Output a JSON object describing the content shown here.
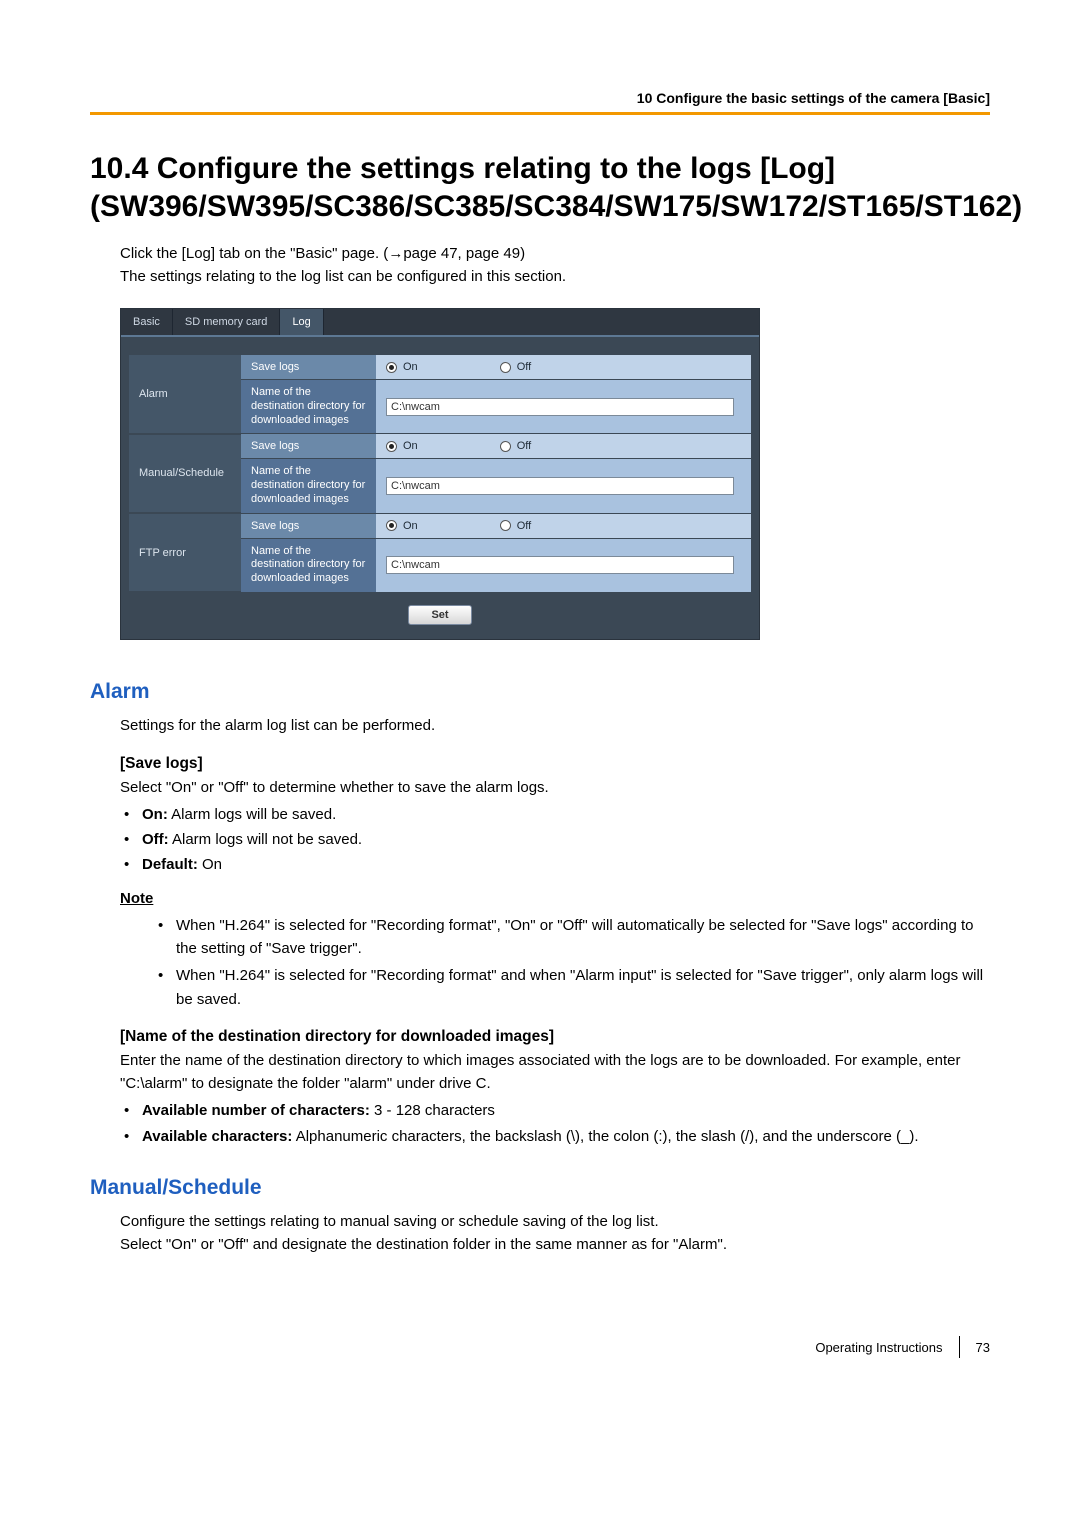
{
  "header": {
    "text": "10 Configure the basic settings of the camera [Basic]"
  },
  "title": "10.4  Configure the settings relating to the logs [Log] (SW396/SW395/SC386/SC385/SC384/SW175/SW172/ST165/ST162)",
  "intro": {
    "line1a": "Click the [Log] tab on the \"Basic\" page. (",
    "line1arrow": "→",
    "line1b": "page 47, page 49)",
    "line2": "The settings relating to the log list can be configured in this section."
  },
  "screenshot": {
    "tabs": {
      "basic": "Basic",
      "sd": "SD memory card",
      "log": "Log"
    },
    "saveLogsLabel": "Save logs",
    "destLabel": "Name of the destination directory for downloaded images",
    "onLabel": "On",
    "offLabel": "Off",
    "rows": {
      "alarm": {
        "cat": "Alarm",
        "value": "C:\\nwcam"
      },
      "manual": {
        "cat": "Manual/Schedule",
        "value": "C:\\nwcam"
      },
      "ftp": {
        "cat": "FTP error",
        "value": "C:\\nwcam"
      }
    },
    "setButton": "Set"
  },
  "alarm": {
    "heading": "Alarm",
    "desc": "Settings for the alarm log list can be performed.",
    "saveLogs": {
      "head": "[Save logs]",
      "desc": "Select \"On\" or \"Off\" to determine whether to save the alarm logs.",
      "on": {
        "label": "On:",
        "text": " Alarm logs will be saved."
      },
      "off": {
        "label": "Off:",
        "text": " Alarm logs will not be saved."
      },
      "def": {
        "label": "Default:",
        "text": " On"
      }
    },
    "noteHead": "Note",
    "notes": {
      "n1": "When \"H.264\" is selected for \"Recording format\", \"On\" or \"Off\" will automatically be selected for \"Save logs\" according to the setting of \"Save trigger\".",
      "n2": "When \"H.264\" is selected for \"Recording format\" and when \"Alarm input\" is selected for \"Save trigger\", only alarm logs will be saved."
    },
    "destDir": {
      "head": "[Name of the destination directory for downloaded images]",
      "desc": "Enter the name of the destination directory to which images associated with the logs are to be downloaded. For example, enter \"C:\\alarm\" to designate the folder \"alarm\" under drive C.",
      "chars": {
        "label": "Available number of characters:",
        "text": " 3 - 128 characters"
      },
      "avail": {
        "label": "Available characters:",
        "text": " Alphanumeric characters, the backslash (\\), the colon (:), the slash (/), and the underscore (_)."
      }
    }
  },
  "manual": {
    "heading": "Manual/Schedule",
    "line1": "Configure the settings relating to manual saving or schedule saving of the log list.",
    "line2": "Select \"On\" or \"Off\" and designate the destination folder in the same manner as for \"Alarm\"."
  },
  "footer": {
    "label": "Operating Instructions",
    "page": "73"
  }
}
